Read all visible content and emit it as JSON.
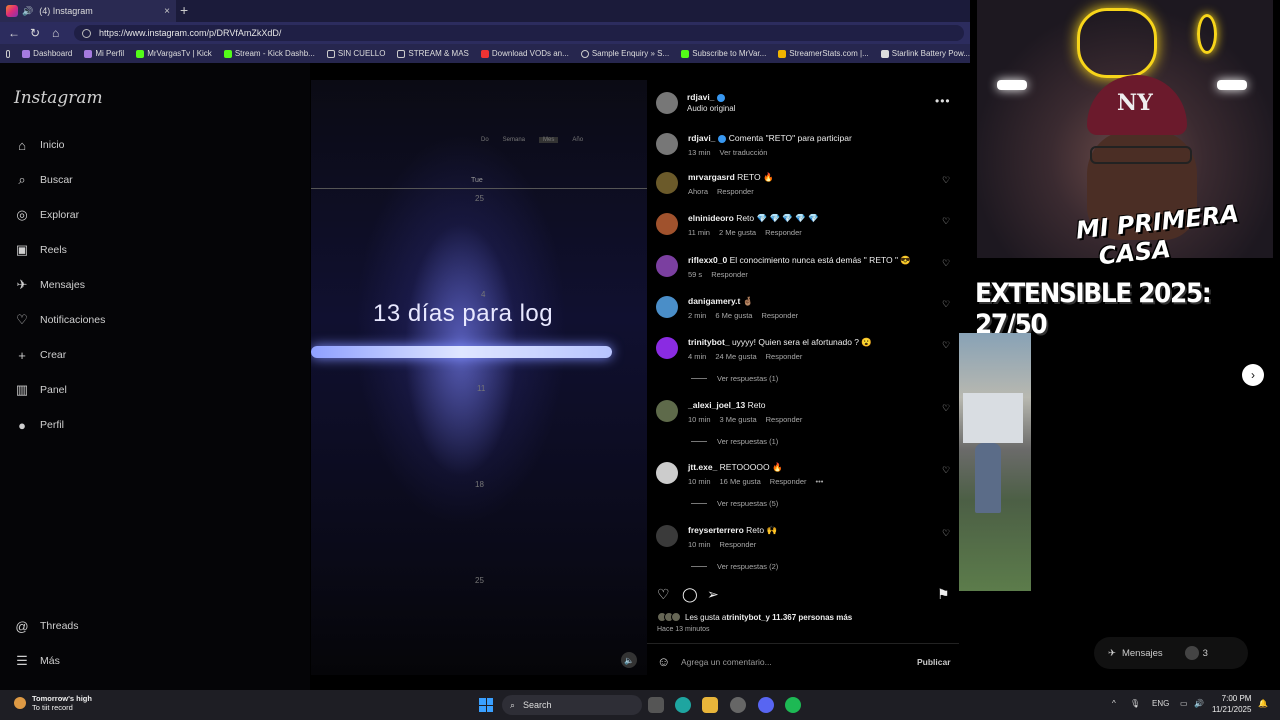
{
  "browser": {
    "tab_title": "(4) Instagram",
    "tab_close": "×",
    "new_tab": "+",
    "url": "https://www.instagram.com/p/DRVfAmZkXdD/",
    "bookmarks": [
      "Dashboard",
      "Mi Perfil",
      "MrVargasTv | Kick",
      "Stream - Kick Dashb...",
      "SIN CUELLO",
      "STREAM & MAS",
      "Download VODs an...",
      "Sample Enquiry » S...",
      "Subscribe to MrVar...",
      "StreamerStats.com |...",
      "Starlink Battery Pow..."
    ]
  },
  "sidebar": {
    "logo": "Instagram",
    "items": [
      {
        "label": "Inicio",
        "icon": "⌂"
      },
      {
        "label": "Buscar",
        "icon": "⌕"
      },
      {
        "label": "Explorar",
        "icon": "◎"
      },
      {
        "label": "Reels",
        "icon": "▣"
      },
      {
        "label": "Mensajes",
        "icon": "✈"
      },
      {
        "label": "Notificaciones",
        "icon": "♡"
      },
      {
        "label": "Crear",
        "icon": "+"
      },
      {
        "label": "Panel",
        "icon": "▥"
      },
      {
        "label": "Perfil",
        "icon": "●"
      }
    ],
    "threads": "Threads",
    "more": "Más"
  },
  "video": {
    "tabs": [
      "Do",
      "Semana",
      "Mes",
      "Año"
    ],
    "day_label": "Tue",
    "numbers": [
      "25",
      "4",
      "11",
      "18",
      "25"
    ],
    "overlay_text": "13 días para log",
    "mute_icon": "🔈"
  },
  "post": {
    "author": "rdjavi_",
    "audio": "Audio original",
    "caption_user": "rdjavi_",
    "caption_text": "Comenta \"RETO\" para participar",
    "caption_time": "13 min",
    "caption_translate": "Ver traducción",
    "comments": [
      {
        "user": "mrvargasrd",
        "text": "RETO 🔥",
        "time": "Ahora",
        "likes": "",
        "reply": "Responder",
        "color": "#6b5a2a"
      },
      {
        "user": "elninideoro",
        "text": "Reto 💎 💎 💎 💎 💎",
        "time": "11 min",
        "likes": "2 Me gusta",
        "reply": "Responder",
        "color": "#a0522d"
      },
      {
        "user": "riflexx0_0",
        "text": "El conocimiento nunca está demás \" RETO \" 😎",
        "time": "59 s",
        "likes": "",
        "reply": "Responder",
        "color": "#7b3fa0"
      },
      {
        "user": "danigamery.t",
        "text": "🤞🏽",
        "time": "2 min",
        "likes": "6 Me gusta",
        "reply": "Responder",
        "color": "#4a8ec8"
      },
      {
        "user": "trinitybot_",
        "text": "uyyyy! Quien sera el afortunado ? 😮",
        "time": "4 min",
        "likes": "24 Me gusta",
        "reply": "Responder",
        "color": "#8a2be2"
      },
      {
        "user": "_alexi_joel_13",
        "text": "Reto",
        "time": "10 min",
        "likes": "3 Me gusta",
        "reply": "Responder",
        "color": "#5e6a4a"
      },
      {
        "user": "jtt.exe_",
        "text": "RETOOOOO 🔥",
        "time": "10 min",
        "likes": "16 Me gusta",
        "reply": "Responder",
        "color": "#cccccc"
      },
      {
        "user": "freyserterrero",
        "text": "Reto 🙌",
        "time": "10 min",
        "likes": "",
        "reply": "Responder",
        "color": "#3a3a3a"
      }
    ],
    "replies": [
      "Ver respuestas (1)",
      "Ver respuestas (1)",
      "Ver respuestas (5)",
      "Ver respuestas (2)"
    ],
    "likes_text_prefix": "Les gusta a ",
    "likes_user": "trinitybot_",
    "likes_suffix": " y 11.367 personas más",
    "posted_ago": "Hace 13 minutos",
    "add_comment_placeholder": "Agrega un comentario...",
    "publish": "Publicar",
    "more_dots": "•••"
  },
  "stream": {
    "overlay": "EXTENSIBLE 2025: 27/50",
    "cam_logo_line1": "MI PRIMERA",
    "cam_logo_line2": "CASA",
    "cap_logo": "NY",
    "next_arrow": "›",
    "messages_pill": "Mensajes",
    "messages_count": "3"
  },
  "taskbar": {
    "weather_title": "Tomorrow's high",
    "weather_sub": "To tiit record",
    "search": "Search",
    "lang": "ENG",
    "time": "7:00 PM",
    "date": "11/21/2025"
  }
}
